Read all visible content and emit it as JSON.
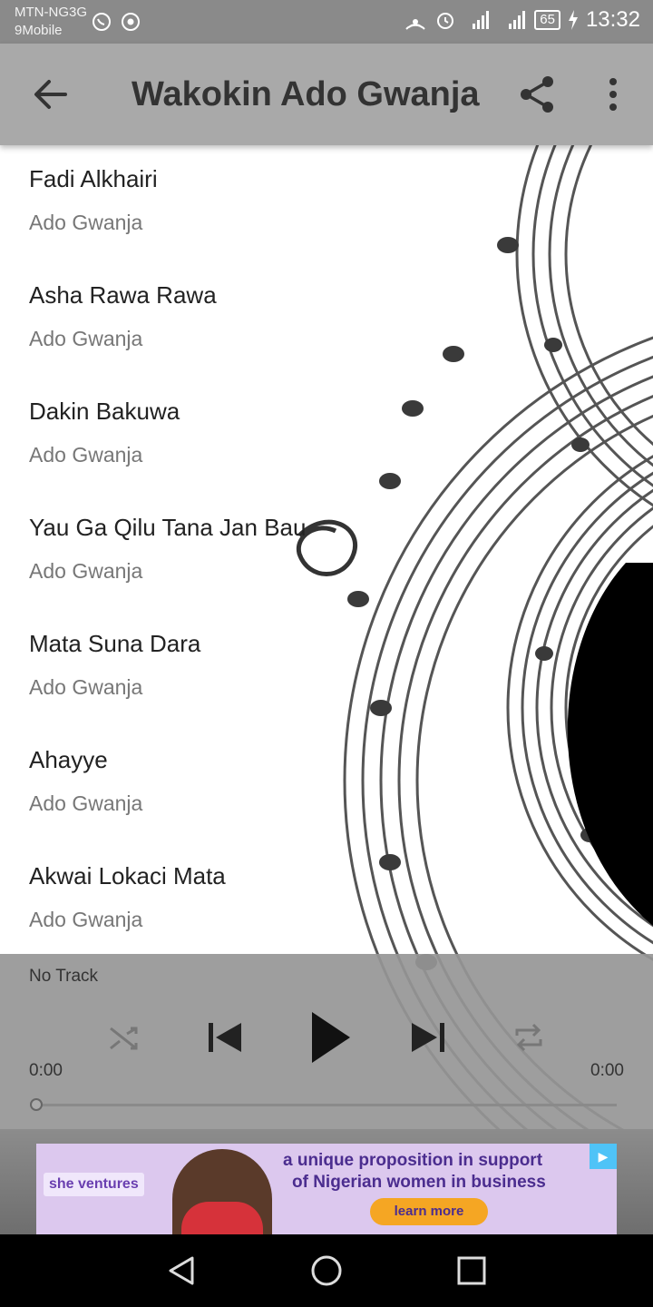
{
  "status_bar": {
    "carrier_line1": "MTN-NG3G",
    "carrier_line2": "9Mobile",
    "battery": "65",
    "time": "13:32"
  },
  "app_bar": {
    "title": "Wakokin Ado Gwanja"
  },
  "tracks": [
    {
      "title": "Fadi Alkhairi",
      "artist": "Ado Gwanja"
    },
    {
      "title": "Asha Rawa Rawa",
      "artist": "Ado Gwanja"
    },
    {
      "title": "Dakin Bakuwa",
      "artist": "Ado Gwanja"
    },
    {
      "title": "Yau Ga Qilu Tana Jan Bau",
      "artist": "Ado Gwanja"
    },
    {
      "title": "Mata Suna Dara",
      "artist": "Ado Gwanja"
    },
    {
      "title": "Ahayye",
      "artist": "Ado Gwanja"
    },
    {
      "title": "Akwai Lokaci Mata",
      "artist": "Ado Gwanja"
    }
  ],
  "player": {
    "now_playing": "No Track",
    "time_elapsed": "0:00",
    "time_total": "0:00",
    "progress": 0
  },
  "ad": {
    "brand": "she ventures",
    "line1": "a unique proposition in support",
    "line2": "of Nigerian women in business",
    "cta": "learn more"
  }
}
